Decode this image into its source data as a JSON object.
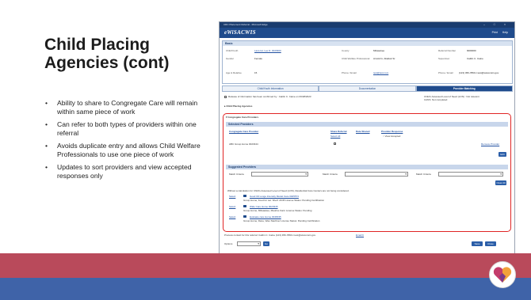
{
  "slide": {
    "title": "Child Placing Agencies (cont)",
    "bullets": [
      "Ability to share to Congregate Care will remain within same piece of work",
      "Can refer to both types of providers within one referral",
      "Avoids duplicate entry and allows Child Welfare Professionals to use one piece of work",
      "Updates to sort providers and view accepted responses only"
    ],
    "colors": {
      "band_red": "#b94a5b",
      "band_blue": "#3f63a8",
      "accent_blue": "#1f4b8c"
    }
  },
  "screenshot": {
    "window_title": "CRC Placement Referral - Microsoft Edge",
    "window_controls": "– □ ×",
    "brand": "eWiSACWIS",
    "top_links": [
      "Print",
      "Help"
    ],
    "basic": {
      "header": "Basic",
      "fields": [
        {
          "label": "Child/Youth",
          "value": "Last-cat, Lee D. 0020900",
          "link": true
        },
        {
          "label": "County",
          "value": "Milwaukee",
          "link": false
        },
        {
          "label": "Referral Number",
          "value": "9000000",
          "link": false
        },
        {
          "label": "Gender",
          "value": "Female",
          "link": false
        },
        {
          "label": "Child Welfare Professional",
          "value": "Arnold G. Ababuk Sr.",
          "link": false
        },
        {
          "label": "Supervisor",
          "value": "Caitlin C. Caine",
          "link": false
        },
        {
          "label": "Age & Relative",
          "value": "15",
          "link": false
        },
        {
          "label": "Phone / Email",
          "value": "test@test.com",
          "link": true
        },
        {
          "label": "Phone / Email",
          "value": "(123) 456-7890  c.test@wisconsin.gov",
          "link": false
        }
      ]
    },
    "tabs": [
      "Child/Youth Information",
      "Documentation",
      "Provider Matching"
    ],
    "release_note": "Release of information has been confirmed by : Caitlin C. Caine on 06/28/2023",
    "right_note": "Child's Assessed Level of Need (LON) : Not relevant\nCANS: Not completed",
    "child_placing": "Child Placing Agencies",
    "congregate": "Congregate Care Providers",
    "selected": {
      "header": "Selected Providers",
      "columns": [
        "Congregate Care Provider",
        "Share Referral",
        "Date Shared",
        "Provider Response"
      ],
      "select_all": "Select All",
      "view_accepted": "View Accepted",
      "row": {
        "provider": "ABC Group Home 0023344",
        "action": "Remove Provider"
      },
      "button": "Edit"
    },
    "suggested": {
      "header": "Suggested Providers",
      "criteria": [
        "Match Criteria",
        "Match Criteria",
        "Match Criteria"
      ],
      "clear": "Clear All",
      "intro": "Without a calculation for Child's Assessed Level of Need (LON), Residential Care Centers are not being considered.",
      "select_label": "Select",
      "providers": [
        {
          "name": "Good Oil Lunge Intensity Model Care 0025573",
          "detail": "Group Home, Food for Lar. Shelf. 29 IB    License Status: Pending Certification"
        },
        {
          "name": "Wide Care Home 0020345",
          "detail": "Group Home, Milwaukee, Maurice Farm    License Status: Pending"
        },
        {
          "name": "Evaluate care Home 0048435",
          "detail": "Group Home, Dane, Wau Stachner    License Status: Pending Certification"
        }
      ]
    },
    "footer": {
      "contact": "Process contact for this referral: Caitlin C. Caine  (123) 456-7890  c.test@wisconsin.gov",
      "email_link": "Email It",
      "options": "Options",
      "go": "Go",
      "save": "Save",
      "close": "Close"
    }
  }
}
